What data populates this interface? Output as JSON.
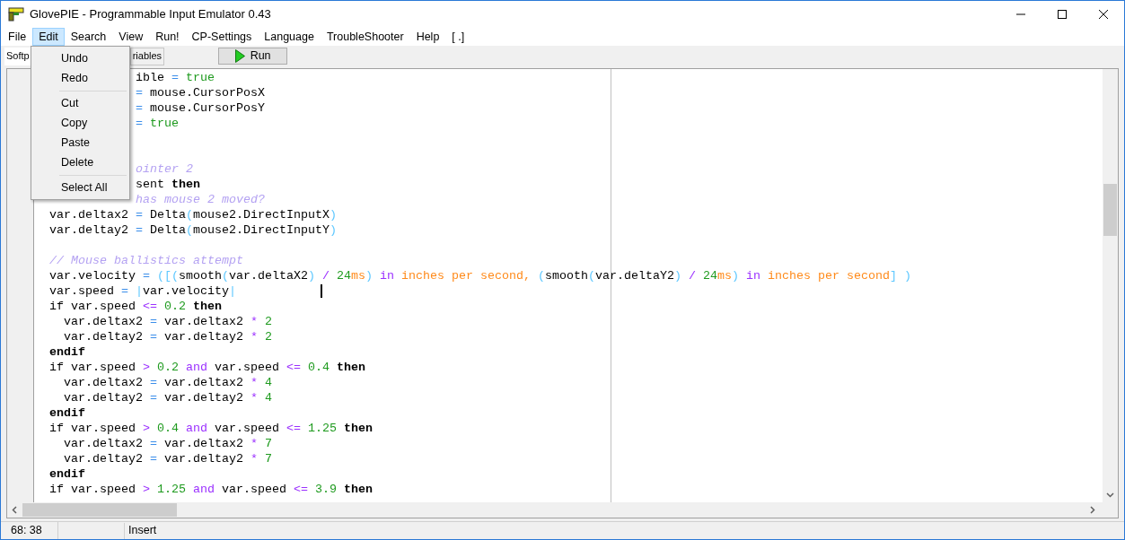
{
  "window": {
    "title": "GlovePIE - Programmable Input Emulator 0.43"
  },
  "menu": [
    {
      "label": "File",
      "selected": false
    },
    {
      "label": "Edit",
      "selected": true
    },
    {
      "label": "Search",
      "selected": false
    },
    {
      "label": "View",
      "selected": false
    },
    {
      "label": "Run!",
      "selected": false
    },
    {
      "label": "CP-Settings",
      "selected": false
    },
    {
      "label": "Language",
      "selected": false
    },
    {
      "label": "TroubleShooter",
      "selected": false
    },
    {
      "label": "Help",
      "selected": false
    },
    {
      "label": "[ .]",
      "selected": false
    }
  ],
  "edit_menu": [
    {
      "kind": "item",
      "label": "Undo"
    },
    {
      "kind": "item",
      "label": "Redo"
    },
    {
      "kind": "separator"
    },
    {
      "kind": "item",
      "label": "Cut"
    },
    {
      "kind": "item",
      "label": "Copy"
    },
    {
      "kind": "item",
      "label": "Paste"
    },
    {
      "kind": "item",
      "label": "Delete"
    },
    {
      "kind": "separator"
    },
    {
      "kind": "item",
      "label": "Select All"
    }
  ],
  "tabs": [
    {
      "label": "Softp",
      "selected": true
    },
    {
      "label": "riables",
      "selected": false
    }
  ],
  "run_button": {
    "label": "Run"
  },
  "code_lines": [
    {
      "kind": "code",
      "tokens": [
        {
          "kind": "text",
          "text": "            ible "
        },
        {
          "kind": "assign",
          "text": "="
        },
        {
          "kind": "bool",
          "text": " true"
        }
      ]
    },
    {
      "kind": "code",
      "tokens": [
        {
          "kind": "assign",
          "text": "            ="
        },
        {
          "kind": "text",
          "text": " mouse.CursorPosX"
        }
      ]
    },
    {
      "kind": "code",
      "tokens": [
        {
          "kind": "assign",
          "text": "            ="
        },
        {
          "kind": "text",
          "text": " mouse.CursorPosY"
        }
      ]
    },
    {
      "kind": "code",
      "tokens": [
        {
          "kind": "assign",
          "text": "            ="
        },
        {
          "kind": "bool",
          "text": " true"
        }
      ]
    },
    {
      "kind": "blank"
    },
    {
      "kind": "blank"
    },
    {
      "kind": "code",
      "tokens": [
        {
          "kind": "comment",
          "text": "            ointer 2"
        }
      ]
    },
    {
      "kind": "code",
      "tokens": [
        {
          "kind": "text",
          "text": "            sent "
        },
        {
          "kind": "keyword",
          "text": "then"
        }
      ]
    },
    {
      "kind": "code",
      "tokens": [
        {
          "kind": "comment",
          "text": "            has mouse 2 moved?"
        }
      ]
    },
    {
      "kind": "code",
      "tokens": [
        {
          "kind": "text",
          "text": "var.deltax2 "
        },
        {
          "kind": "assign",
          "text": "="
        },
        {
          "kind": "text",
          "text": " Delta"
        },
        {
          "kind": "bracket",
          "text": "("
        },
        {
          "kind": "text",
          "text": "mouse2.DirectInputX"
        },
        {
          "kind": "bracket",
          "text": ")"
        }
      ]
    },
    {
      "kind": "code",
      "tokens": [
        {
          "kind": "text",
          "text": "var.deltay2 "
        },
        {
          "kind": "assign",
          "text": "="
        },
        {
          "kind": "text",
          "text": " Delta"
        },
        {
          "kind": "bracket",
          "text": "("
        },
        {
          "kind": "text",
          "text": "mouse2.DirectInputY"
        },
        {
          "kind": "bracket",
          "text": ")"
        }
      ]
    },
    {
      "kind": "blank"
    },
    {
      "kind": "code",
      "tokens": [
        {
          "kind": "comment",
          "text": "// Mouse ballistics attempt"
        }
      ]
    },
    {
      "kind": "code",
      "tokens": [
        {
          "kind": "text",
          "text": "var.velocity "
        },
        {
          "kind": "assign",
          "text": "="
        },
        {
          "kind": "bracket",
          "text": " ([("
        },
        {
          "kind": "text",
          "text": "smooth"
        },
        {
          "kind": "bracket",
          "text": "("
        },
        {
          "kind": "text",
          "text": "var.deltaX2"
        },
        {
          "kind": "bracket",
          "text": ")"
        },
        {
          "kind": "op",
          "text": " /"
        },
        {
          "kind": "number",
          "text": " 24"
        },
        {
          "kind": "unit",
          "text": "ms"
        },
        {
          "kind": "bracket",
          "text": ")"
        },
        {
          "kind": "op",
          "text": " in"
        },
        {
          "kind": "unit",
          "text": " inches per second,"
        },
        {
          "kind": "bracket",
          "text": " ("
        },
        {
          "kind": "text",
          "text": "smooth"
        },
        {
          "kind": "bracket",
          "text": "("
        },
        {
          "kind": "text",
          "text": "var.deltaY2"
        },
        {
          "kind": "bracket",
          "text": ")"
        },
        {
          "kind": "op",
          "text": " /"
        },
        {
          "kind": "number",
          "text": " 24"
        },
        {
          "kind": "unit",
          "text": "ms"
        },
        {
          "kind": "bracket",
          "text": ")"
        },
        {
          "kind": "op",
          "text": " in"
        },
        {
          "kind": "unit",
          "text": " inches per second"
        },
        {
          "kind": "bracket",
          "text": "] )"
        }
      ]
    },
    {
      "kind": "code",
      "caret": true,
      "tokens": [
        {
          "kind": "text",
          "text": "var.speed "
        },
        {
          "kind": "assign",
          "text": "="
        },
        {
          "kind": "bracket",
          "text": " |"
        },
        {
          "kind": "text",
          "text": "var.velocity"
        },
        {
          "kind": "bracket",
          "text": "|"
        }
      ]
    },
    {
      "kind": "code",
      "tokens": [
        {
          "kind": "text",
          "text": "if var.speed "
        },
        {
          "kind": "op",
          "text": "<="
        },
        {
          "kind": "number",
          "text": " 0.2"
        },
        {
          "kind": "keyword",
          "text": " then"
        }
      ]
    },
    {
      "kind": "code",
      "tokens": [
        {
          "kind": "text",
          "text": "  var.deltax2 "
        },
        {
          "kind": "assign",
          "text": "="
        },
        {
          "kind": "text",
          "text": " var.deltax2 "
        },
        {
          "kind": "op",
          "text": "*"
        },
        {
          "kind": "number",
          "text": " 2"
        }
      ]
    },
    {
      "kind": "code",
      "tokens": [
        {
          "kind": "text",
          "text": "  var.deltay2 "
        },
        {
          "kind": "assign",
          "text": "="
        },
        {
          "kind": "text",
          "text": " var.deltay2 "
        },
        {
          "kind": "op",
          "text": "*"
        },
        {
          "kind": "number",
          "text": " 2"
        }
      ]
    },
    {
      "kind": "code",
      "tokens": [
        {
          "kind": "keyword",
          "text": "endif"
        }
      ]
    },
    {
      "kind": "code",
      "tokens": [
        {
          "kind": "text",
          "text": "if var.speed "
        },
        {
          "kind": "op",
          "text": ">"
        },
        {
          "kind": "number",
          "text": " 0.2"
        },
        {
          "kind": "op",
          "text": " and"
        },
        {
          "kind": "text",
          "text": " var.speed "
        },
        {
          "kind": "op",
          "text": "<="
        },
        {
          "kind": "number",
          "text": " 0.4"
        },
        {
          "kind": "keyword",
          "text": " then"
        }
      ]
    },
    {
      "kind": "code",
      "tokens": [
        {
          "kind": "text",
          "text": "  var.deltax2 "
        },
        {
          "kind": "assign",
          "text": "="
        },
        {
          "kind": "text",
          "text": " var.deltax2 "
        },
        {
          "kind": "op",
          "text": "*"
        },
        {
          "kind": "number",
          "text": " 4"
        }
      ]
    },
    {
      "kind": "code",
      "tokens": [
        {
          "kind": "text",
          "text": "  var.deltay2 "
        },
        {
          "kind": "assign",
          "text": "="
        },
        {
          "kind": "text",
          "text": " var.deltay2 "
        },
        {
          "kind": "op",
          "text": "*"
        },
        {
          "kind": "number",
          "text": " 4"
        }
      ]
    },
    {
      "kind": "code",
      "tokens": [
        {
          "kind": "keyword",
          "text": "endif"
        }
      ]
    },
    {
      "kind": "code",
      "tokens": [
        {
          "kind": "text",
          "text": "if var.speed "
        },
        {
          "kind": "op",
          "text": ">"
        },
        {
          "kind": "number",
          "text": " 0.4"
        },
        {
          "kind": "op",
          "text": " and"
        },
        {
          "kind": "text",
          "text": " var.speed "
        },
        {
          "kind": "op",
          "text": "<="
        },
        {
          "kind": "number",
          "text": " 1.25"
        },
        {
          "kind": "keyword",
          "text": " then"
        }
      ]
    },
    {
      "kind": "code",
      "tokens": [
        {
          "kind": "text",
          "text": "  var.deltax2 "
        },
        {
          "kind": "assign",
          "text": "="
        },
        {
          "kind": "text",
          "text": " var.deltax2 "
        },
        {
          "kind": "op",
          "text": "*"
        },
        {
          "kind": "number",
          "text": " 7"
        }
      ]
    },
    {
      "kind": "code",
      "tokens": [
        {
          "kind": "text",
          "text": "  var.deltay2 "
        },
        {
          "kind": "assign",
          "text": "="
        },
        {
          "kind": "text",
          "text": " var.deltay2 "
        },
        {
          "kind": "op",
          "text": "*"
        },
        {
          "kind": "number",
          "text": " 7"
        }
      ]
    },
    {
      "kind": "code",
      "tokens": [
        {
          "kind": "keyword",
          "text": "endif"
        }
      ]
    },
    {
      "kind": "code",
      "tokens": [
        {
          "kind": "text",
          "text": "if var.speed "
        },
        {
          "kind": "op",
          "text": ">"
        },
        {
          "kind": "number",
          "text": " 1.25"
        },
        {
          "kind": "op",
          "text": " and"
        },
        {
          "kind": "text",
          "text": " var.speed "
        },
        {
          "kind": "op",
          "text": "<="
        },
        {
          "kind": "number",
          "text": " 3.9"
        },
        {
          "kind": "keyword",
          "text": " then"
        }
      ]
    }
  ],
  "status_bar": {
    "position": "68: 38",
    "mode": "Insert"
  }
}
